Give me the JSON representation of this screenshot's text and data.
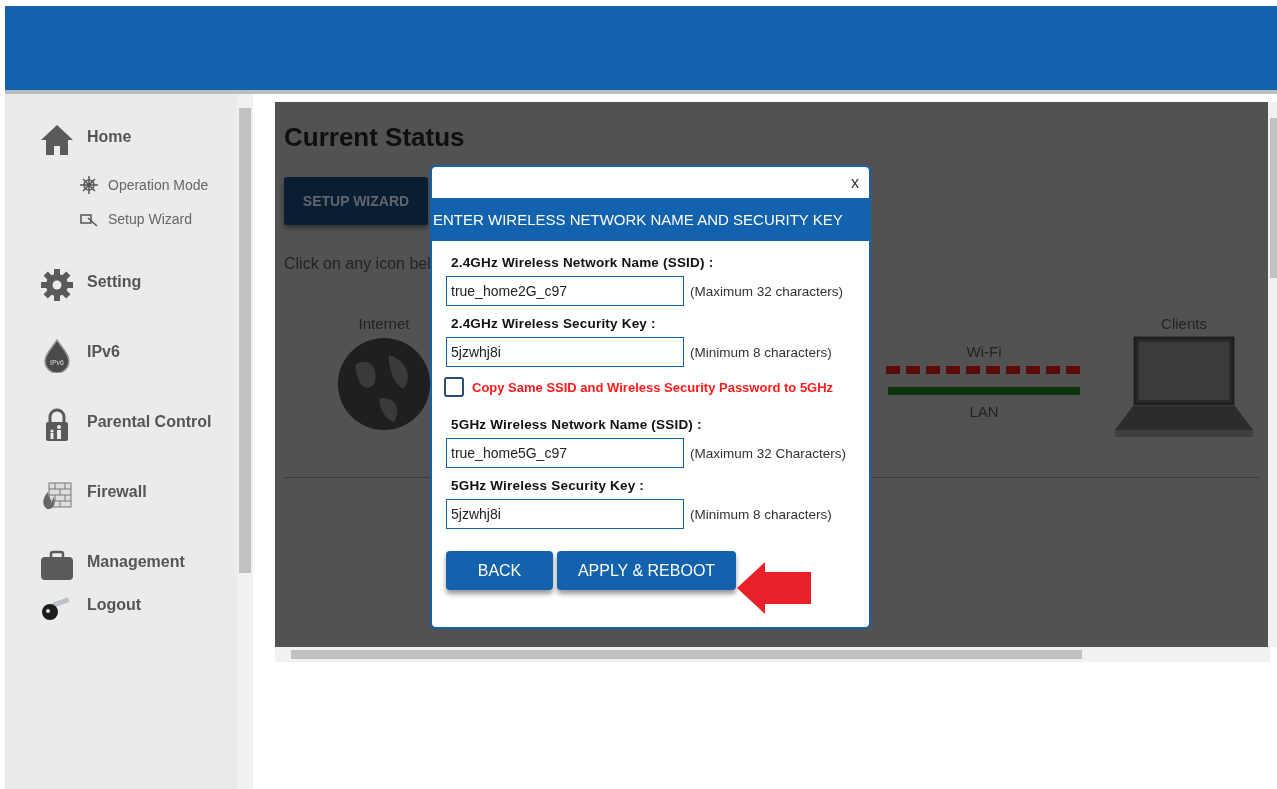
{
  "sidebar": {
    "items": [
      {
        "label": "Home",
        "kind": "home",
        "children": [
          {
            "label": "Operation Mode",
            "kind": "wheel"
          },
          {
            "label": "Setup Wizard",
            "kind": "wizard"
          }
        ]
      },
      {
        "label": "Setting",
        "kind": "gear"
      },
      {
        "label": "IPv6",
        "kind": "ipv6",
        "icon_text": "IPv6"
      },
      {
        "label": "Parental Control",
        "kind": "lock"
      },
      {
        "label": "Firewall",
        "kind": "firewall"
      },
      {
        "label": "Management",
        "kind": "briefcase"
      },
      {
        "label": "Logout",
        "kind": "key"
      }
    ]
  },
  "status": {
    "title": "Current Status",
    "wizard_button": "SETUP WIZARD",
    "hint": "Click on any icon bel",
    "internet_label": "Internet",
    "wifi_label": "Wi-Fi",
    "lan_label": "LAN",
    "clients_label": "Clients"
  },
  "dialog": {
    "close": "x",
    "title": "ENTER WIRELESS NETWORK NAME AND SECURITY KEY",
    "fields_24": [
      {
        "label": "2.4GHz Wireless Network Name (SSID) :",
        "value": "true_home2G_c97",
        "note": "(Maximum 32 characters)"
      },
      {
        "label": "2.4GHz Wireless Security Key :",
        "value": "5jzwhj8i",
        "note": "(Minimum 8 characters)"
      }
    ],
    "copy_checkbox": {
      "label": "Copy Same SSID and Wireless Security Password to 5GHz",
      "checked": false
    },
    "fields_5": [
      {
        "label": "5GHz Wireless Network Name (SSID) :",
        "value": "true_home5G_c97",
        "note": "(Maximum 32 Characters)"
      },
      {
        "label": "5GHz Wireless Security Key :",
        "value": "5jzwhj8i",
        "note": "(Minimum 8 characters)"
      }
    ],
    "buttons": [
      "BACK",
      "APPLY & REBOOT"
    ]
  }
}
